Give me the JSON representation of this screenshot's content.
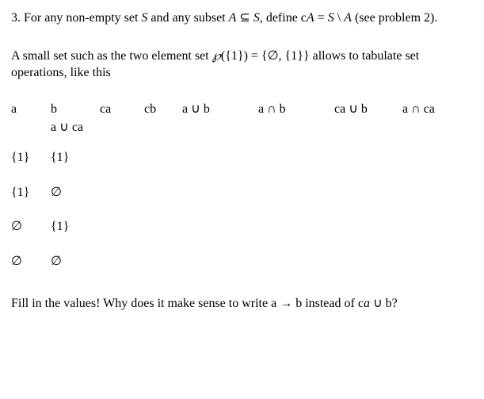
{
  "problem": {
    "number": "3.",
    "def_text_1": " For any non-empty set ",
    "S": "S",
    "def_text_2": " and any subset ",
    "A": "A",
    "subset": " ⊆ ",
    "def_text_3": ", define c",
    "A2": "A",
    "eq": " = ",
    "S2": "S",
    "setminus": " \\ ",
    "A3": "A",
    "def_text_4": " (see problem 2)."
  },
  "intro": {
    "t1": "A small set such as the two element set ",
    "wp": "℘",
    "t2": "({1}) = {∅, {1}} allows to tabulate set operations, like this"
  },
  "headers": {
    "a": "a",
    "b": "b",
    "ca": "ca",
    "cb": "cb",
    "aub": "a ∪ b",
    "anb": "a ∩ b",
    "caub": "ca ∪ b",
    "anca": "a ∩ ca",
    "auca": "a ∪ ca"
  },
  "chart_data": {
    "type": "table",
    "columns": [
      "a",
      "b",
      "ca",
      "cb",
      "a ∪ b",
      "a ∩ b",
      "ca ∪ b",
      "a ∩ ca",
      "a ∪ ca"
    ],
    "rows": [
      {
        "a": "{1}",
        "b": "{1}",
        "ca": "",
        "cb": "",
        "aub": "",
        "anb": "",
        "caub": "",
        "anca": "",
        "auca": ""
      },
      {
        "a": "{1}",
        "b": "∅",
        "ca": "",
        "cb": "",
        "aub": "",
        "anb": "",
        "caub": "",
        "anca": "",
        "auca": ""
      },
      {
        "a": "∅",
        "b": "{1}",
        "ca": "",
        "cb": "",
        "aub": "",
        "anb": "",
        "caub": "",
        "anca": "",
        "auca": ""
      },
      {
        "a": "∅",
        "b": "∅",
        "ca": "",
        "cb": "",
        "aub": "",
        "anb": "",
        "caub": "",
        "anca": "",
        "auca": ""
      }
    ]
  },
  "final": {
    "t1": "Fill in the values! Why does it make sense to write a → b instead of c",
    "a": "a",
    "t2": " ∪ b?"
  }
}
